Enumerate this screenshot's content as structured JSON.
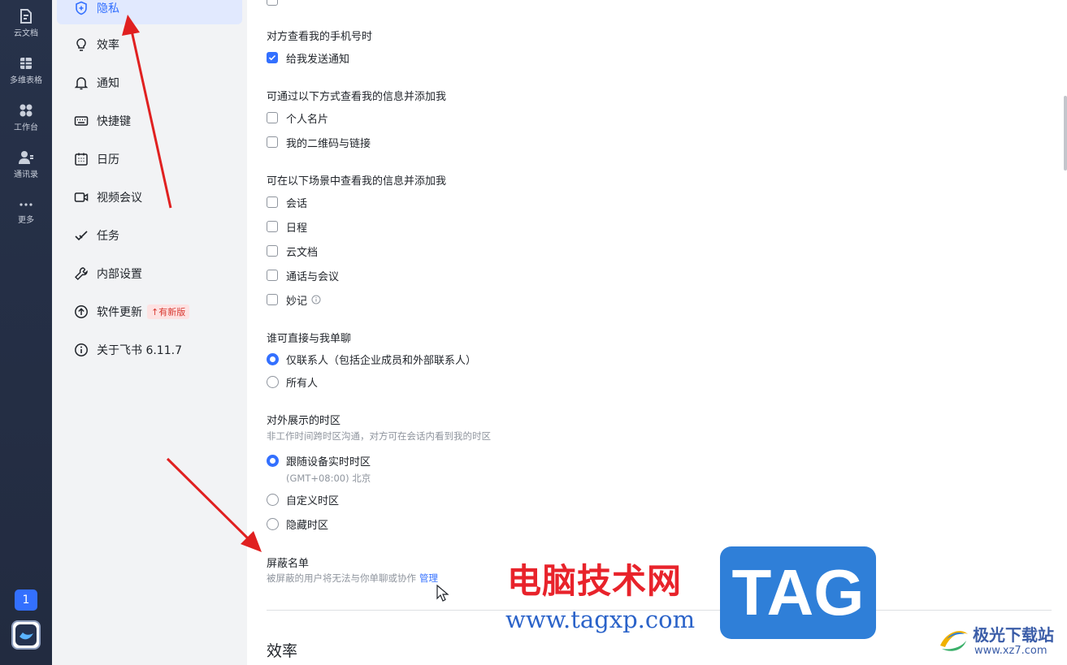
{
  "rail": {
    "items": [
      {
        "label": "云文档",
        "icon": "doc-icon"
      },
      {
        "label": "多维表格",
        "icon": "table-icon"
      },
      {
        "label": "工作台",
        "icon": "apps-grid-icon"
      },
      {
        "label": "通讯录",
        "icon": "contacts-icon"
      },
      {
        "label": "更多",
        "icon": "more-dots-icon"
      }
    ],
    "badge": "1"
  },
  "sidebar": {
    "items": [
      {
        "label": "隐私",
        "icon": "shield-icon",
        "active": true
      },
      {
        "label": "效率",
        "icon": "bulb-icon"
      },
      {
        "label": "通知",
        "icon": "bell-icon"
      },
      {
        "label": "快捷键",
        "icon": "keyboard-icon"
      },
      {
        "label": "日历",
        "icon": "calendar-icon"
      },
      {
        "label": "视频会议",
        "icon": "video-icon"
      },
      {
        "label": "任务",
        "icon": "task-check-icon"
      },
      {
        "label": "内部设置",
        "icon": "wrench-icon"
      },
      {
        "label": "软件更新",
        "icon": "upload-circle-icon",
        "badge": "有新版"
      },
      {
        "label": "关于飞书 6.11.7",
        "icon": "info-circle-icon"
      }
    ]
  },
  "main": {
    "phone_view": {
      "title": "对方查看我的手机号时",
      "options": [
        {
          "label": "给我发送通知",
          "checked": true
        }
      ]
    },
    "add_by_info": {
      "title": "可通过以下方式查看我的信息并添加我",
      "options": [
        {
          "label": "个人名片",
          "checked": false
        },
        {
          "label": "我的二维码与链接",
          "checked": false
        }
      ]
    },
    "scenes": {
      "title": "可在以下场景中查看我的信息并添加我",
      "options": [
        {
          "label": "会话",
          "checked": false
        },
        {
          "label": "日程",
          "checked": false
        },
        {
          "label": "云文档",
          "checked": false
        },
        {
          "label": "通话与会议",
          "checked": false
        },
        {
          "label": "妙记",
          "checked": false
        }
      ]
    },
    "direct_chat": {
      "title": "谁可直接与我单聊",
      "options": [
        {
          "label": "仅联系人（包括企业成员和外部联系人）",
          "checked": true
        },
        {
          "label": "所有人",
          "checked": false
        }
      ]
    },
    "timezone": {
      "title": "对外展示的时区",
      "subtitle": "非工作时间跨时区沟通，对方可在会话内看到我的时区",
      "options": [
        {
          "label": "跟随设备实时时区",
          "checked": true,
          "note": "(GMT+08:00) 北京"
        },
        {
          "label": "自定义时区",
          "checked": false
        },
        {
          "label": "隐藏时区",
          "checked": false
        }
      ]
    },
    "blocklist": {
      "title": "屏蔽名单",
      "subtitle": "被屏蔽的用户将无法与你单聊或协作",
      "manage_link": "管理"
    },
    "next_section_title": "效率"
  },
  "watermark": {
    "cn_text": "电脑技术网",
    "url": "www.tagxp.com",
    "tag": "TAG",
    "logo_text": "极光下载站",
    "logo_url": "www.xz7.com"
  },
  "colors": {
    "accent": "#3370ff",
    "rail_bg": "#27324a",
    "sidebar_bg": "#f2f3f5",
    "arrow_red": "#e02020"
  }
}
